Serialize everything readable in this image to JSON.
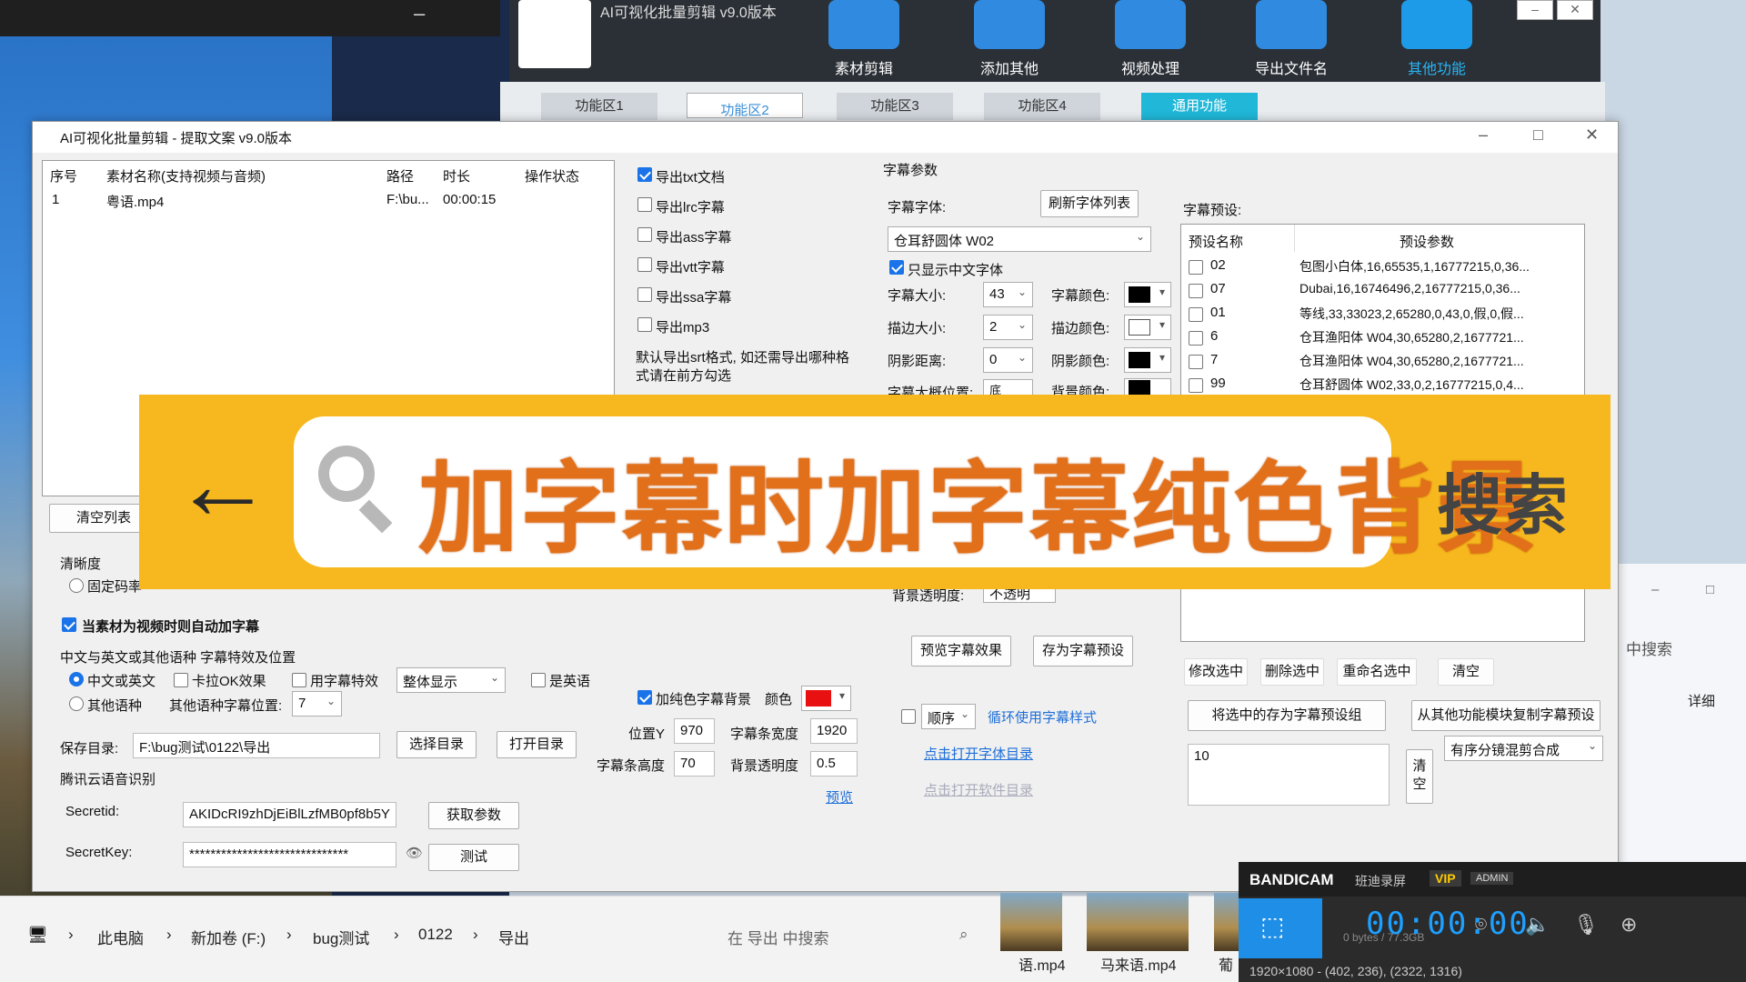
{
  "background": {
    "right_search": "中搜索",
    "right_detail": "详细"
  },
  "main_app": {
    "title": "AI可视化批量剪辑 v9.0版本",
    "toolbar": [
      "素材剪辑",
      "添加其他",
      "视频处理",
      "导出文件名",
      "其他功能"
    ],
    "tabs": [
      "功能区1",
      "功能区2",
      "功能区3",
      "功能区4",
      "通用功能"
    ]
  },
  "dialog": {
    "title": "AI可视化批量剪辑 - 提取文案  v9.0版本",
    "list": {
      "headers": [
        "序号",
        "素材名称(支持视频与音频)",
        "路径",
        "时长",
        "操作状态"
      ],
      "rows": [
        [
          "1",
          "粤语.mp4",
          "F:\\bu...",
          "00:00:15",
          ""
        ]
      ]
    },
    "clear_list": "清空列表",
    "clarity_label": "清晰度",
    "fixed_bitrate": "固定码率",
    "auto_subtitle": "当素材为视频时则自动加字幕",
    "effect_section": "中文与英文或其他语种 字幕特效及位置",
    "zh_en": "中文或英文",
    "karaoke": "卡拉OK效果",
    "use_effect": "用字幕特效",
    "display_mode": "整体显示",
    "is_english": "是英语",
    "other_lang": "其他语种",
    "other_pos_label": "其他语种字幕位置:",
    "other_pos": "7",
    "save_dir_label": "保存目录:",
    "save_dir": "F:\\bug测试\\0122\\导出",
    "choose_dir": "选择目录",
    "open_dir": "打开目录",
    "tencent": "腾讯云语音识别",
    "secretid_label": "Secretid:",
    "secretid": "AKIDcRI9zhDjEiBlLzfMB0pf8b5Y",
    "get_params": "获取参数",
    "secretkey_label": "SecretKey:",
    "secretkey": "******************************",
    "test": "测试",
    "exports": [
      "导出txt文档",
      "导出lrc字幕",
      "导出ass字幕",
      "导出vtt字幕",
      "导出ssa字幕",
      "导出mp3"
    ],
    "export_note": "默认导出srt格式, 如还需导出哪种格式请在前方勾选",
    "pure_bg": "加纯色字幕背景",
    "color_label": "颜色",
    "pos_y_label": "位置Y",
    "pos_y": "970",
    "bar_width_label": "字幕条宽度",
    "bar_width": "1920",
    "bar_height_label": "字幕条高度",
    "bar_height": "70",
    "bg_opacity_label": "背景透明度",
    "bg_opacity": "0.5",
    "preview_link": "预览",
    "sub_params": "字幕参数",
    "sub_font_label": "字幕字体:",
    "refresh_fonts": "刷新字体列表",
    "font": "仓耳舒圆体 W02",
    "only_cn": "只显示中文字体",
    "size_label": "字幕大小:",
    "size": "43",
    "color_sub_label": "字幕颜色:",
    "stroke_label": "描边大小:",
    "stroke": "2",
    "stroke_color_label": "描边颜色:",
    "shadow_label": "阴影距离:",
    "shadow": "0",
    "shadow_color_label": "阴影颜色:",
    "pos_label": "字幕大概位置:",
    "pos": "底",
    "bg_color_label": "背景颜色:",
    "bg_trans_label": "背景透明度:",
    "bg_trans": "不透明",
    "preview_effect": "预览字幕效果",
    "save_preset": "存为字幕预设",
    "order": "顺序",
    "loop_style": "循环使用字幕样式",
    "open_font_dir": "点击打开字体目录",
    "open_soft_dir": "点击打开软件目录",
    "presets_label": "字幕预设:",
    "presets_headers": [
      "预设名称",
      "预设参数"
    ],
    "presets": [
      [
        "02",
        "包图小白体,16,65535,1,16777215,0,36..."
      ],
      [
        "07",
        "Dubai,16,16746496,2,16777215,0,36..."
      ],
      [
        "01",
        "等线,33,33023,2,65280,0,43,0,假,0,假..."
      ],
      [
        "6",
        "仓耳渔阳体 W04,30,65280,2,1677721..."
      ],
      [
        "7",
        "仓耳渔阳体 W04,30,65280,2,1677721..."
      ],
      [
        "99",
        "仓耳舒圆体 W02,33,0,2,16777215,0,4..."
      ]
    ],
    "modify": "修改选中",
    "delete": "删除选中",
    "rename": "重命名选中",
    "clear": "清空",
    "save_group": "将选中的存为字幕预设组",
    "copy_from": "从其他功能模块复制字幕预设",
    "textarea_val": "10",
    "clear_v": "清空",
    "mix_mode": "有序分镜混剪合成",
    "colors": {
      "red": "#e81010",
      "black": "#000000",
      "white": "#ffffff"
    }
  },
  "banner": {
    "query": "加字幕时加字幕纯色背景",
    "search_btn": "搜索"
  },
  "explorer": {
    "crumbs": [
      "此电脑",
      "新加卷 (F:)",
      "bug测试",
      "0122",
      "导出"
    ],
    "search_placeholder": "在 导出 中搜索",
    "files": [
      "语.mp4",
      "马来语.mp4",
      "葡"
    ]
  },
  "bandicam": {
    "brand": "BANDICAM",
    "sub": "班迪录屏",
    "vip": "VIP",
    "admin": "ADMIN",
    "timer": "00:00:00",
    "size": "0 bytes / 77.3GB",
    "region": "1920×1080 - (402, 236), (2322, 1316)"
  }
}
